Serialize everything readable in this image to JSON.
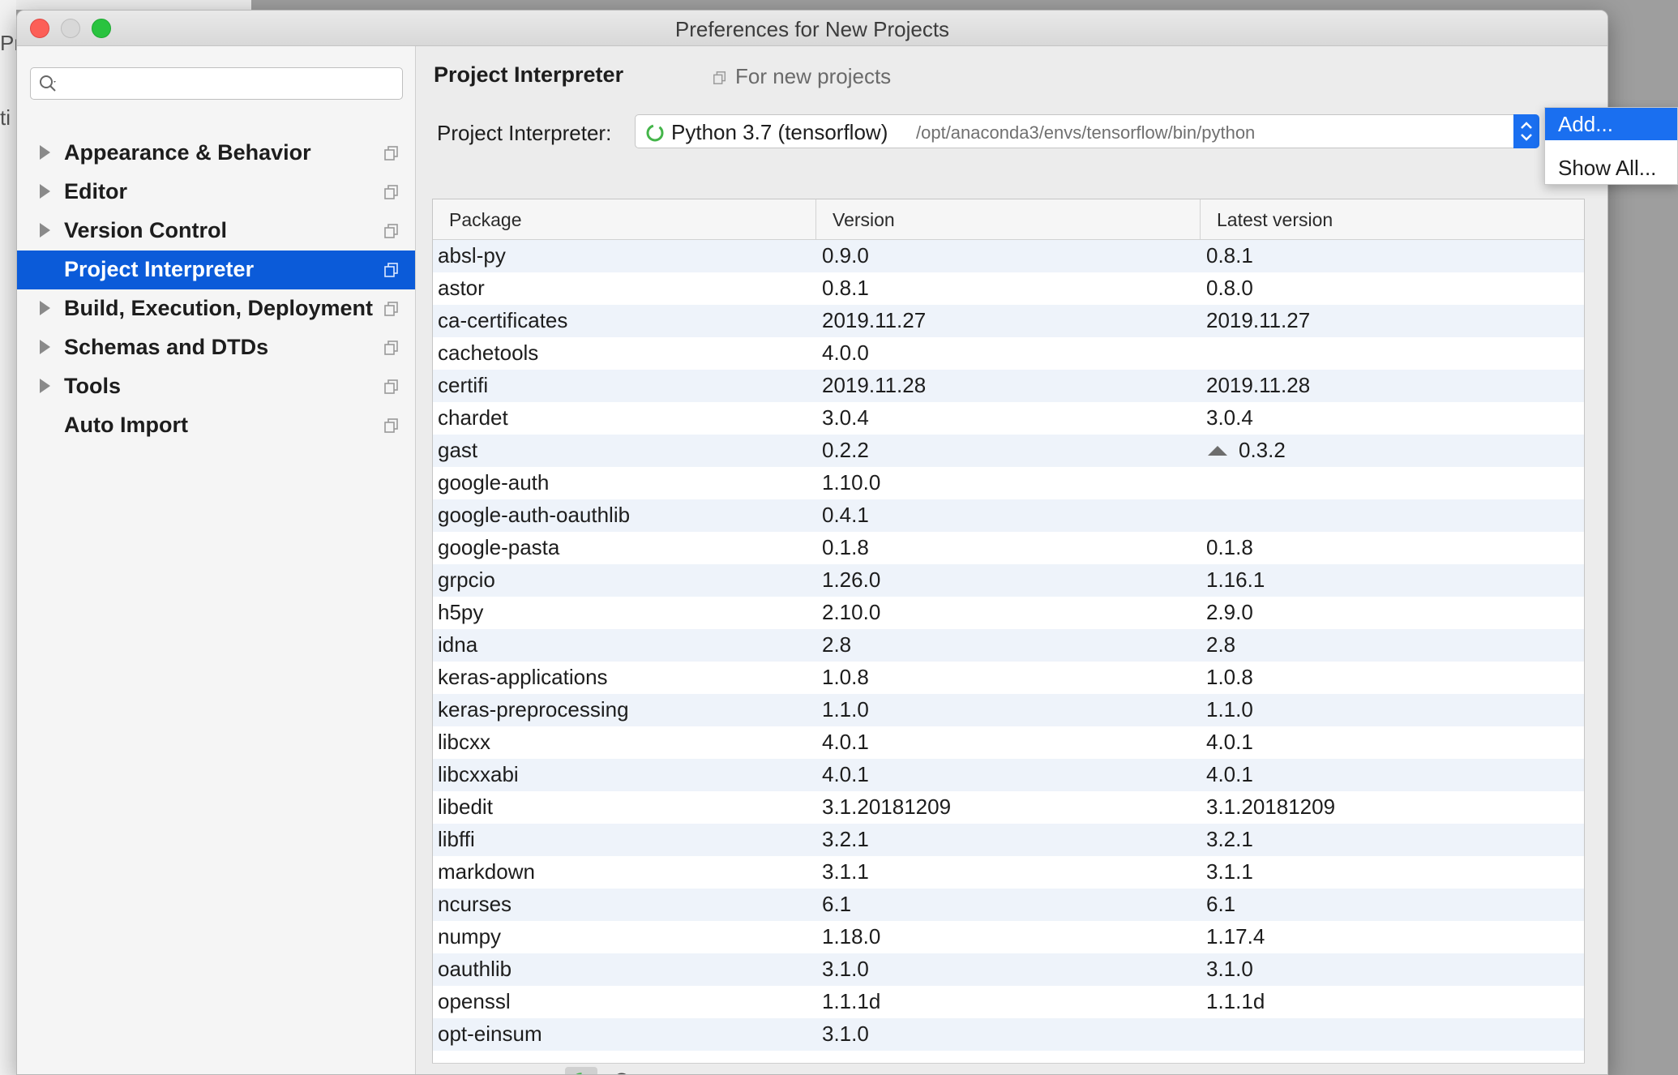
{
  "background": {
    "left_glyphs": [
      "Pro",
      "ti"
    ]
  },
  "window": {
    "title": "Preferences for New Projects"
  },
  "sidebar": {
    "search": {
      "value": "",
      "placeholder": ""
    },
    "items": [
      {
        "label": "Appearance & Behavior",
        "expandable": true,
        "selected": false
      },
      {
        "label": "Editor",
        "expandable": true,
        "selected": false
      },
      {
        "label": "Version Control",
        "expandable": true,
        "selected": false
      },
      {
        "label": "Project Interpreter",
        "expandable": false,
        "selected": true
      },
      {
        "label": "Build, Execution, Deployment",
        "expandable": true,
        "selected": false
      },
      {
        "label": "Schemas and DTDs",
        "expandable": true,
        "selected": false
      },
      {
        "label": "Tools",
        "expandable": true,
        "selected": false
      },
      {
        "label": "Auto Import",
        "expandable": false,
        "selected": false
      }
    ]
  },
  "main": {
    "title": "Project Interpreter",
    "scope": "For new projects",
    "interpreter": {
      "label": "Project Interpreter:",
      "name": "Python 3.7 (tensorflow)",
      "path": "/opt/anaconda3/envs/tensorflow/bin/python"
    },
    "dropdown": {
      "items": [
        "Add...",
        "Show All..."
      ]
    },
    "table": {
      "columns": [
        "Package",
        "Version",
        "Latest version"
      ],
      "rows": [
        {
          "package": "absl-py",
          "version": "0.9.0",
          "latest": "0.8.1",
          "upgrade": false
        },
        {
          "package": "astor",
          "version": "0.8.1",
          "latest": "0.8.0",
          "upgrade": false
        },
        {
          "package": "ca-certificates",
          "version": "2019.11.27",
          "latest": "2019.11.27",
          "upgrade": false
        },
        {
          "package": "cachetools",
          "version": "4.0.0",
          "latest": "",
          "upgrade": false
        },
        {
          "package": "certifi",
          "version": "2019.11.28",
          "latest": "2019.11.28",
          "upgrade": false
        },
        {
          "package": "chardet",
          "version": "3.0.4",
          "latest": "3.0.4",
          "upgrade": false
        },
        {
          "package": "gast",
          "version": "0.2.2",
          "latest": "0.3.2",
          "upgrade": true
        },
        {
          "package": "google-auth",
          "version": "1.10.0",
          "latest": "",
          "upgrade": false
        },
        {
          "package": "google-auth-oauthlib",
          "version": "0.4.1",
          "latest": "",
          "upgrade": false
        },
        {
          "package": "google-pasta",
          "version": "0.1.8",
          "latest": "0.1.8",
          "upgrade": false
        },
        {
          "package": "grpcio",
          "version": "1.26.0",
          "latest": "1.16.1",
          "upgrade": false
        },
        {
          "package": "h5py",
          "version": "2.10.0",
          "latest": "2.9.0",
          "upgrade": false
        },
        {
          "package": "idna",
          "version": "2.8",
          "latest": "2.8",
          "upgrade": false
        },
        {
          "package": "keras-applications",
          "version": "1.0.8",
          "latest": "1.0.8",
          "upgrade": false
        },
        {
          "package": "keras-preprocessing",
          "version": "1.1.0",
          "latest": "1.1.0",
          "upgrade": false
        },
        {
          "package": "libcxx",
          "version": "4.0.1",
          "latest": "4.0.1",
          "upgrade": false
        },
        {
          "package": "libcxxabi",
          "version": "4.0.1",
          "latest": "4.0.1",
          "upgrade": false
        },
        {
          "package": "libedit",
          "version": "3.1.20181209",
          "latest": "3.1.20181209",
          "upgrade": false
        },
        {
          "package": "libffi",
          "version": "3.2.1",
          "latest": "3.2.1",
          "upgrade": false
        },
        {
          "package": "markdown",
          "version": "3.1.1",
          "latest": "3.1.1",
          "upgrade": false
        },
        {
          "package": "ncurses",
          "version": "6.1",
          "latest": "6.1",
          "upgrade": false
        },
        {
          "package": "numpy",
          "version": "1.18.0",
          "latest": "1.17.4",
          "upgrade": false
        },
        {
          "package": "oauthlib",
          "version": "3.1.0",
          "latest": "3.1.0",
          "upgrade": false
        },
        {
          "package": "openssl",
          "version": "1.1.1d",
          "latest": "1.1.1d",
          "upgrade": false
        },
        {
          "package": "opt-einsum",
          "version": "3.1.0",
          "latest": "",
          "upgrade": false
        }
      ]
    },
    "toolbar": {
      "add": "+",
      "remove": "−",
      "upgrade_icon": "upgrade-icon",
      "refresh_icon": "refresh-icon",
      "show_early_icon": "eye-icon"
    }
  },
  "colors": {
    "selection": "#0b5bd9",
    "accent": "#1a6ff0",
    "row_stripe": "#eef3fa"
  }
}
